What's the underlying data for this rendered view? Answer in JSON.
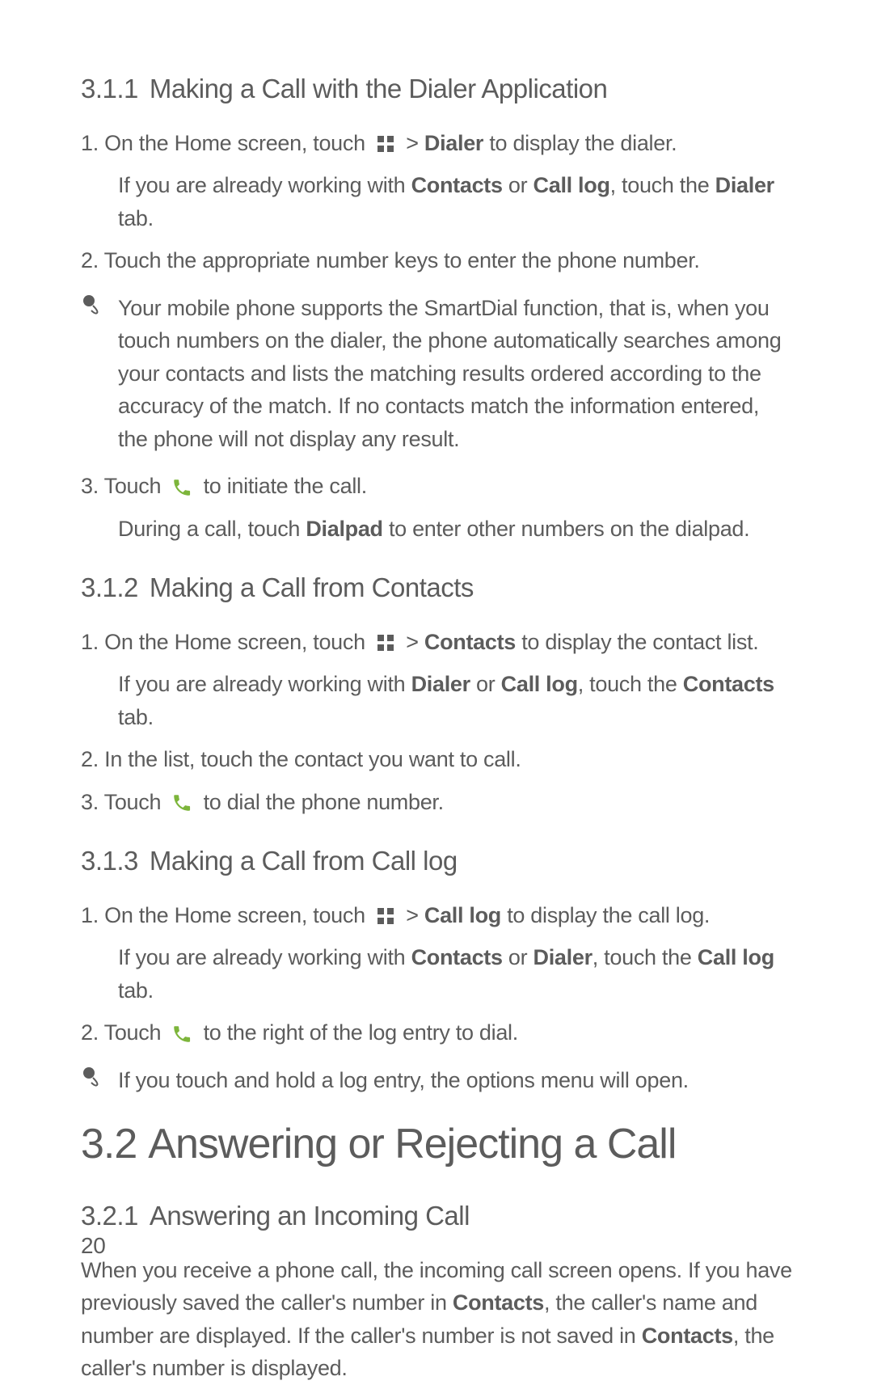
{
  "s311": {
    "num": "3.1.1",
    "title": "Making a Call with the Dialer Application",
    "step1_a": "1. On the Home screen, touch",
    "step1_b": ">",
    "step1_bold": "Dialer",
    "step1_c": "to display the dialer.",
    "step1_sub_a": "If you are already working with",
    "step1_sub_b": "Contacts",
    "step1_sub_c": "or",
    "step1_sub_d": "Call log",
    "step1_sub_e": ", touch the",
    "step1_sub_f": "Dialer",
    "step1_sub_g": "tab.",
    "step2": "2. Touch the appropriate number keys to enter the phone number.",
    "note1": "Your mobile phone supports the SmartDial function, that is, when you touch numbers on the dialer, the phone automatically searches among your contacts and lists the matching results ordered according to the accuracy of the match. If no contacts match the information entered, the phone will not display any result.",
    "step3_a": "3. Touch",
    "step3_b": "to initiate the call.",
    "step3_sub_a": "During a call, touch",
    "step3_sub_b": "Dialpad",
    "step3_sub_c": "to enter other numbers on the dialpad."
  },
  "s312": {
    "num": "3.1.2",
    "title": "Making a Call from Contacts",
    "step1_a": "1. On the Home screen, touch",
    "step1_b": ">",
    "step1_bold": "Contacts",
    "step1_c": "to display the contact list.",
    "step1_sub_a": "If you are already working with",
    "step1_sub_b": "Dialer",
    "step1_sub_c": "or",
    "step1_sub_d": "Call log",
    "step1_sub_e": ", touch the",
    "step1_sub_f": "Contacts",
    "step1_sub_g": "tab.",
    "step2": "2. In the list, touch the contact you want to call.",
    "step3_a": "3. Touch",
    "step3_b": "to dial the phone number."
  },
  "s313": {
    "num": "3.1.3",
    "title": "Making a Call from Call log",
    "step1_a": "1. On the Home screen, touch",
    "step1_b": ">",
    "step1_bold": "Call log",
    "step1_c": "to display the call log.",
    "step1_sub_a": "If you are already working with",
    "step1_sub_b": "Contacts",
    "step1_sub_c": "or",
    "step1_sub_d": "Dialer",
    "step1_sub_e": ", touch the",
    "step1_sub_f": "Call log",
    "step1_sub_g": "tab.",
    "step2_a": "2. Touch",
    "step2_b": "to the right of the log entry to dial.",
    "note1": "If you touch and hold a log entry, the options menu will open."
  },
  "s32": {
    "num": "3.2",
    "title": "Answering or Rejecting a Call"
  },
  "s321": {
    "num": "3.2.1",
    "title": "Answering an Incoming Call",
    "p1_a": "When you receive a phone call, the incoming call screen opens. If you have previously saved the caller's number in",
    "p1_b": "Contacts",
    "p1_c": ", the caller's name and number are displayed. If the caller's number is not saved in",
    "p1_d": "Contacts",
    "p1_e": ", the caller's number is displayed."
  },
  "page_number": "20"
}
